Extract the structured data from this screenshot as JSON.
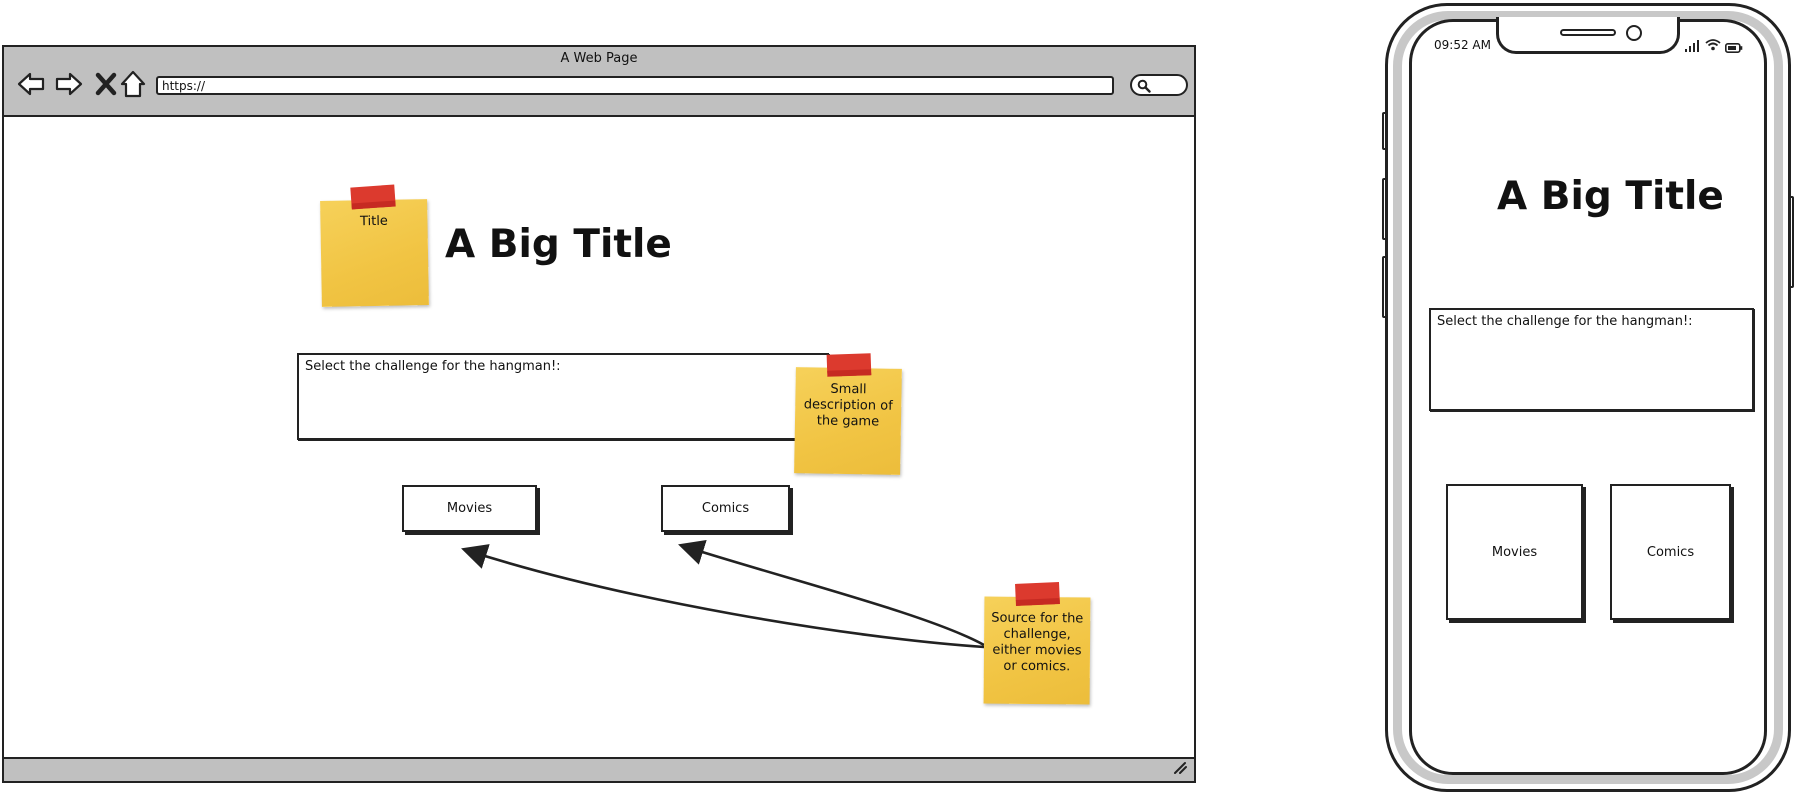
{
  "browser": {
    "window_title": "A Web Page",
    "url": "https://"
  },
  "web": {
    "title": "A Big Title",
    "description": "Select the challenge for the hangman!:",
    "buttons": {
      "movies": "Movies",
      "comics": "Comics"
    }
  },
  "notes": {
    "title": "Title",
    "description": "Small description of the game",
    "source": "Source for the challenge, either movies or comics."
  },
  "phone": {
    "time": "09:52 AM",
    "title": "A Big Title",
    "description": "Select the challenge for the hangman!:",
    "buttons": {
      "movies": "Movies",
      "comics": "Comics"
    }
  },
  "colors": {
    "chrome_gray": "#c0c0c0",
    "sticky_yellow": "#f1c443",
    "tape_red": "#dc3a2e",
    "ink": "#222222"
  },
  "icons": [
    "back-arrow-icon",
    "forward-arrow-icon",
    "close-x-icon",
    "home-icon",
    "search-icon",
    "resize-grip-icon",
    "signal-icon",
    "wifi-icon",
    "battery-icon"
  ]
}
